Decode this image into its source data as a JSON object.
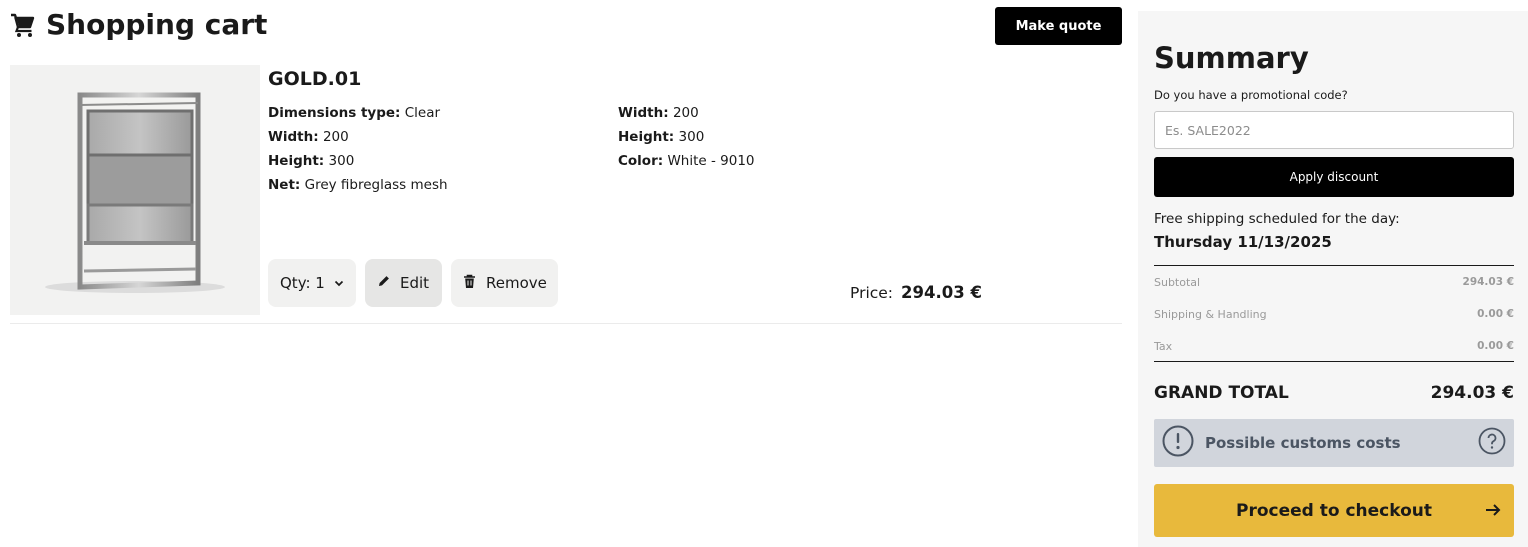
{
  "header": {
    "title": "Shopping cart",
    "cart_icon": "cart-icon",
    "make_quote_label": "Make quote"
  },
  "item": {
    "name": "GOLD.01",
    "image_icon": "window-screen-image",
    "specs_left": [
      {
        "label": "Dimensions type:",
        "value": "Clear"
      },
      {
        "label": "Width:",
        "value": "200"
      },
      {
        "label": "Height:",
        "value": "300"
      },
      {
        "label": "Net:",
        "value": "Grey fibreglass mesh"
      }
    ],
    "specs_right": [
      {
        "label": "Width:",
        "value": "200"
      },
      {
        "label": "Height:",
        "value": "300"
      },
      {
        "label": "Color:",
        "value": "White - 9010"
      }
    ],
    "qty_label": "Qty: 1",
    "edit_label": "Edit",
    "remove_label": "Remove",
    "price_label": "Price:",
    "price_value": "294.03 €"
  },
  "summary": {
    "title": "Summary",
    "promo_question": "Do you have a promotional code?",
    "promo_placeholder": "Es. SALE2022",
    "apply_label": "Apply discount",
    "shipping_note": "Free shipping scheduled for the day:",
    "shipping_date": "Thursday 11/13/2025",
    "subtotal_label": "Subtotal",
    "subtotal_value": "294.03 €",
    "shipping_label": "Shipping & Handling",
    "shipping_value": "0.00 €",
    "tax_label": "Tax",
    "tax_value": "0.00 €",
    "grand_total_label": "GRAND TOTAL",
    "grand_total_value": "294.03 €",
    "customs_label": "Possible customs costs",
    "checkout_label": "Proceed to checkout"
  },
  "colors": {
    "accent_checkout": "#e8b93c",
    "customs_bg": "#d1d5dc",
    "summary_bg": "#f6f6f6",
    "primary_black": "#000000"
  }
}
